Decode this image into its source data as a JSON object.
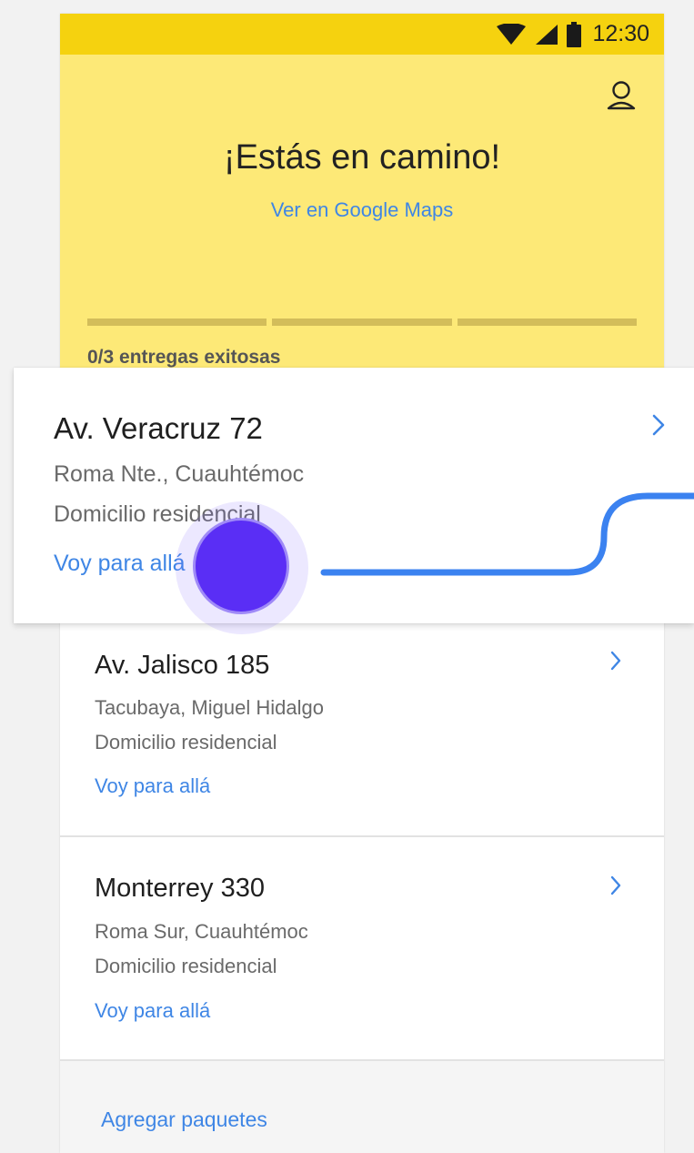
{
  "status_bar": {
    "time": "12:30",
    "icons": [
      "wifi-icon",
      "signal-icon",
      "battery-icon"
    ],
    "color": "#f5d20f"
  },
  "header": {
    "title": "¡Estás en camino!",
    "maps_link": "Ver en Google Maps",
    "progress_completed": 0,
    "progress_total": 3,
    "deliveries_label": "0/3 entregas exitosas",
    "color": "#fde977",
    "profile_icon": "user-icon"
  },
  "deliveries": [
    {
      "address": "Av. Veracruz 72",
      "area": "Roma Nte., Cuauhtémoc",
      "type": "Domicilio residencial",
      "action": "Voy para allá"
    },
    {
      "address": "Av. Jalisco 185",
      "area": "Tacubaya, Miguel Hidalgo",
      "type": "Domicilio residencial",
      "action": "Voy para allá"
    },
    {
      "address": "Monterrey 330",
      "area": "Roma Sur, Cuauhtémoc",
      "type": "Domicilio residencial",
      "action": "Voy para allá"
    }
  ],
  "footer": {
    "add_packages": "Agregar paquetes"
  },
  "colors": {
    "link": "#3f86e5",
    "touch": "#5a2ef5",
    "swipe_path": "#3b82f0"
  }
}
